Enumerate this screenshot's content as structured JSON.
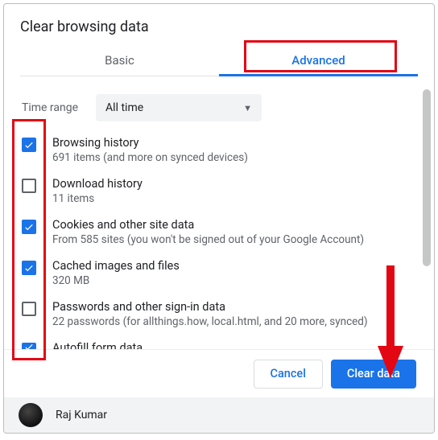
{
  "title": "Clear browsing data",
  "tabs": {
    "basic": "Basic",
    "advanced": "Advanced",
    "active": "advanced"
  },
  "timerange": {
    "label": "Time range",
    "value": "All time"
  },
  "items": [
    {
      "checked": true,
      "title": "Browsing history",
      "subtitle": "691 items (and more on synced devices)"
    },
    {
      "checked": false,
      "title": "Download history",
      "subtitle": "11 items"
    },
    {
      "checked": true,
      "title": "Cookies and other site data",
      "subtitle": "From 585 sites (you won't be signed out of your Google Account)"
    },
    {
      "checked": true,
      "title": "Cached images and files",
      "subtitle": "320 MB"
    },
    {
      "checked": false,
      "title": "Passwords and other sign-in data",
      "subtitle": "22 passwords (for allthings.how, local.html, and 20 more, synced)"
    },
    {
      "checked": true,
      "title": "Autofill form data",
      "subtitle": ""
    }
  ],
  "buttons": {
    "cancel": "Cancel",
    "clear": "Clear data"
  },
  "user": {
    "name": "Raj Kumar"
  },
  "colors": {
    "accent": "#1a73e8",
    "annotation": "#e30613"
  }
}
